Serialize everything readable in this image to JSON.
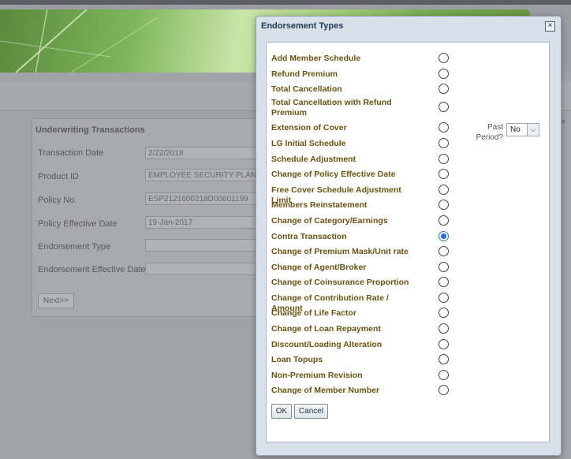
{
  "background": {
    "section_title": "Underwriting Transactions",
    "fields": [
      {
        "label": "Transaction Date",
        "value": "2/22/2018"
      },
      {
        "label": "Product ID",
        "value": "EMPLOYEE SECURITY PLAN"
      },
      {
        "label": "Policy No.",
        "value": "ESP2121600218D00601199"
      },
      {
        "label": "Policy Effective Date",
        "value": "19-Jan-2017"
      },
      {
        "label": "Endorsement Type",
        "value": ""
      },
      {
        "label": "Endorsement Effective Date",
        "value": ""
      }
    ],
    "next_label": "Next>>"
  },
  "dialog": {
    "title": "Endorsement Types",
    "close_glyph": "×",
    "past_period_label": "Past Period?",
    "past_period_value": "No",
    "ok_label": "OK",
    "cancel_label": "Cancel",
    "endorsement_types": [
      {
        "label": "Add Member Schedule",
        "selected": false
      },
      {
        "label": "Refund Premium",
        "selected": false
      },
      {
        "label": "Total Cancellation",
        "selected": false
      },
      {
        "label": "Total Cancellation with Refund Premium",
        "selected": false
      },
      {
        "label": "Extension of Cover",
        "selected": false
      },
      {
        "label": "LG Initial Schedule",
        "selected": false
      },
      {
        "label": "Schedule Adjustment",
        "selected": false
      },
      {
        "label": "Change of Policy Effective Date",
        "selected": false
      },
      {
        "label": "Free Cover Schedule Adjustment Limit",
        "selected": false
      },
      {
        "label": "Members Reinstatement",
        "selected": false
      },
      {
        "label": "Change of Category/Earnings",
        "selected": false
      },
      {
        "label": "Contra Transaction",
        "selected": true
      },
      {
        "label": "Change of Premium Mask/Unit rate",
        "selected": false
      },
      {
        "label": "Change of Agent/Broker",
        "selected": false
      },
      {
        "label": "Change of Coinsurance Proportion",
        "selected": false
      },
      {
        "label": "Change of Contribution Rate / Amount",
        "selected": false
      },
      {
        "label": "Change of Life Factor",
        "selected": false
      },
      {
        "label": "Change of Loan Repayment",
        "selected": false
      },
      {
        "label": "Discount/Loading Alteration",
        "selected": false
      },
      {
        "label": "Loan Topups",
        "selected": false
      },
      {
        "label": "Non-Premium Revision",
        "selected": false
      },
      {
        "label": "Change of Member Number",
        "selected": false
      }
    ]
  }
}
